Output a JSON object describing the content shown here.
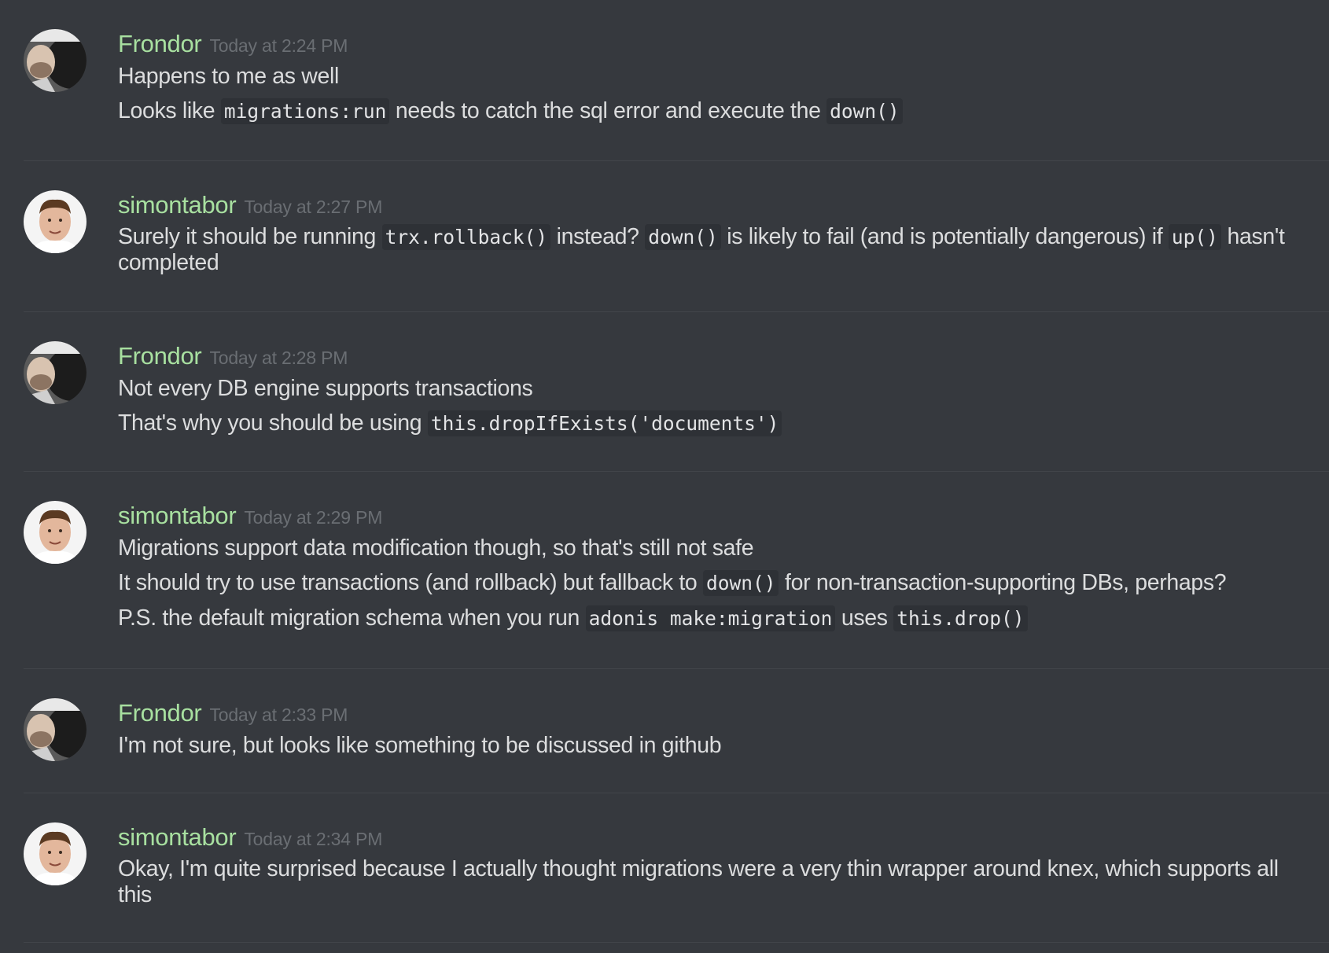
{
  "colors": {
    "background": "#36393e",
    "author_name": "#a8e0a0",
    "timestamp": "#6a6e73",
    "text": "#dcddde",
    "code_bg": "#2e3136",
    "divider": "#42454a"
  },
  "messages": [
    {
      "author": "Frondor",
      "timestamp": "Today at 2:24 PM",
      "avatar_icon": "frondor-avatar",
      "lines": [
        [
          "Happens to me as well"
        ],
        [
          "Looks like ",
          "migrations:run",
          " needs to catch the sql error and execute the ",
          "down()"
        ]
      ]
    },
    {
      "author": "simontabor",
      "timestamp": "Today at 2:27 PM",
      "avatar_icon": "simontabor-avatar",
      "lines": [
        [
          "Surely it should be running ",
          "trx.rollback()",
          " instead? ",
          "down()",
          " is likely to fail (and is potentially dangerous) if ",
          "up()",
          " hasn't completed"
        ]
      ]
    },
    {
      "author": "Frondor",
      "timestamp": "Today at 2:28 PM",
      "avatar_icon": "frondor-avatar",
      "lines": [
        [
          "Not every DB engine supports transactions"
        ],
        [
          "That's why you should be using ",
          "this.dropIfExists('documents')"
        ]
      ]
    },
    {
      "author": "simontabor",
      "timestamp": "Today at 2:29 PM",
      "avatar_icon": "simontabor-avatar",
      "lines": [
        [
          "Migrations support data modification though, so that's still not safe"
        ],
        [
          "It should try to use transactions (and rollback) but fallback to ",
          "down()",
          " for non-transaction-supporting DBs, perhaps?"
        ],
        [
          "P.S. the default migration schema when you run ",
          "adonis make:migration",
          " uses ",
          "this.drop()"
        ]
      ]
    },
    {
      "author": "Frondor",
      "timestamp": "Today at 2:33 PM",
      "avatar_icon": "frondor-avatar",
      "lines": [
        [
          "I'm not sure, but looks like something to be discussed in github"
        ]
      ]
    },
    {
      "author": "simontabor",
      "timestamp": "Today at 2:34 PM",
      "avatar_icon": "simontabor-avatar",
      "lines": [
        [
          "Okay, I'm quite surprised because I actually thought migrations were a very thin wrapper around knex, which supports all this"
        ]
      ]
    }
  ]
}
